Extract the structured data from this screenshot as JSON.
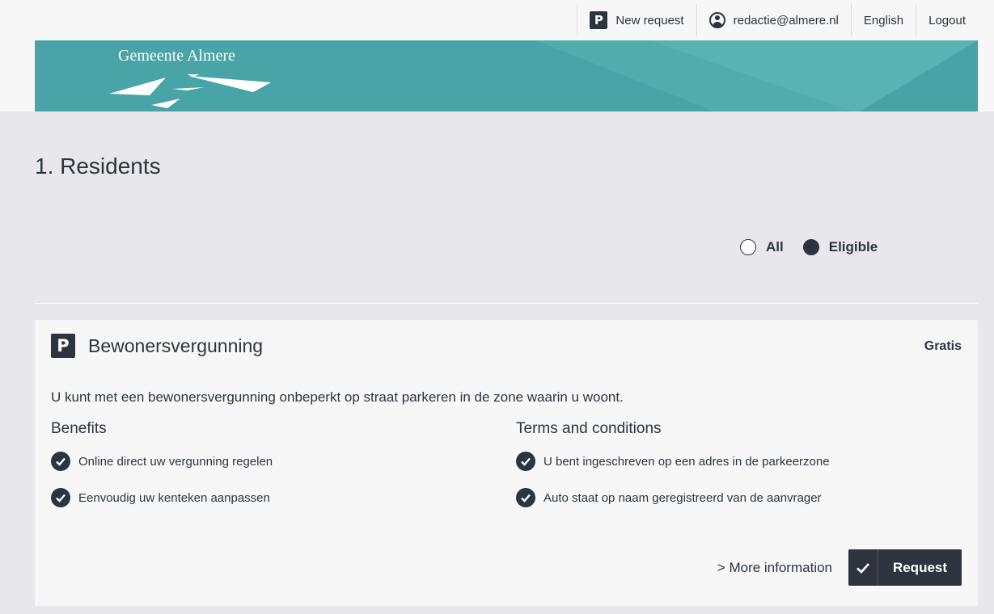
{
  "nav": {
    "new_request": "New request",
    "account_email": "redactie@almere.nl",
    "language": "English",
    "logout": "Logout"
  },
  "banner": {
    "logo_text": "Gemeente Almere"
  },
  "page": {
    "title": "1. Residents"
  },
  "filter": {
    "options": [
      "All",
      "Eligible"
    ],
    "selected": "Eligible"
  },
  "card": {
    "icon_letter": "P",
    "title": "Bewonersvergunning",
    "price": "Gratis",
    "description": "U kunt met een bewonersvergunning onbeperkt op straat parkeren in de zone waarin u woont.",
    "benefits_heading": "Benefits",
    "benefits": [
      "Online direct uw vergunning regelen",
      "Eenvoudig uw kenteken aanpassen"
    ],
    "terms_heading": "Terms and conditions",
    "terms": [
      "U bent ingeschreven op een adres in de parkeerzone",
      "Auto staat op naam geregistreerd van de aanvrager"
    ],
    "more_info": "> More information",
    "request_button": "Request"
  },
  "colors": {
    "accent": "#48a4a6",
    "dark": "#2d3440",
    "background": "#e8e8ec"
  },
  "icons": {
    "parking": "parking-icon",
    "user": "user-circle-icon",
    "check": "check-circle-icon"
  }
}
